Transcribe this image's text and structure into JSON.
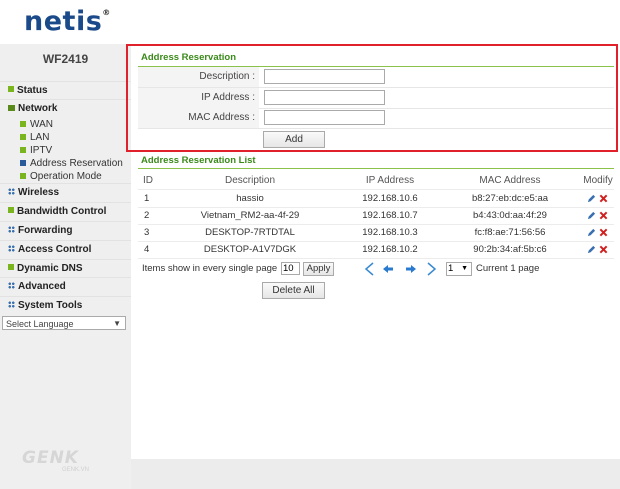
{
  "brand": {
    "logo_text": "netis",
    "trademark": "®",
    "model": "WF2419"
  },
  "sidebar": {
    "items": [
      {
        "label": "Status",
        "icon": "green-square-icon"
      },
      {
        "label": "Network",
        "icon": "list-icon"
      },
      {
        "label": "Wireless",
        "icon": "grid-dots-icon"
      },
      {
        "label": "Bandwidth Control",
        "icon": "green-square-icon"
      },
      {
        "label": "Forwarding",
        "icon": "grid-dots-icon"
      },
      {
        "label": "Access Control",
        "icon": "grid-dots-icon"
      },
      {
        "label": "Dynamic DNS",
        "icon": "green-square-icon"
      },
      {
        "label": "Advanced",
        "icon": "grid-dots-icon"
      },
      {
        "label": "System Tools",
        "icon": "grid-dots-icon"
      }
    ],
    "network_sub": [
      {
        "label": "WAN"
      },
      {
        "label": "LAN"
      },
      {
        "label": "IPTV"
      },
      {
        "label": "Address Reservation"
      },
      {
        "label": "Operation Mode"
      }
    ],
    "language_select": "Select Language"
  },
  "reservation_form": {
    "title": "Address Reservation",
    "description_label": "Description :",
    "ip_label": "IP Address :",
    "mac_label": "MAC Address :",
    "description_value": "",
    "ip_value": "",
    "mac_value": "",
    "add_button": "Add"
  },
  "reservation_list": {
    "title": "Address Reservation List",
    "columns": [
      "ID",
      "Description",
      "IP Address",
      "MAC Address",
      "Modify"
    ],
    "rows": [
      {
        "id": "1",
        "description": "hassio",
        "ip": "192.168.10.6",
        "mac": "b8:27:eb:dc:e5:aa"
      },
      {
        "id": "2",
        "description": "Vietnam_RM2-aa-4f-29",
        "ip": "192.168.10.7",
        "mac": "b4:43:0d:aa:4f:29"
      },
      {
        "id": "3",
        "description": "DESKTOP-7RTDTAL",
        "ip": "192.168.10.3",
        "mac": "fc:f8:ae:71:56:56"
      },
      {
        "id": "4",
        "description": "DESKTOP-A1V7DGK",
        "ip": "192.168.10.2",
        "mac": "90:2b:34:af:5b:c6"
      }
    ],
    "pager": {
      "items_label": "Items show in every single page",
      "items_value": "10",
      "apply_button": "Apply",
      "page_select": "1",
      "current_page": "Current 1 page"
    },
    "delete_all_button": "Delete All"
  },
  "watermark": {
    "text": "GENK",
    "sub": "GENK.VN"
  },
  "colors": {
    "accent_green": "#3a8a1a",
    "highlight_red": "#e0202a",
    "brand_blue": "#1a4a8a"
  }
}
